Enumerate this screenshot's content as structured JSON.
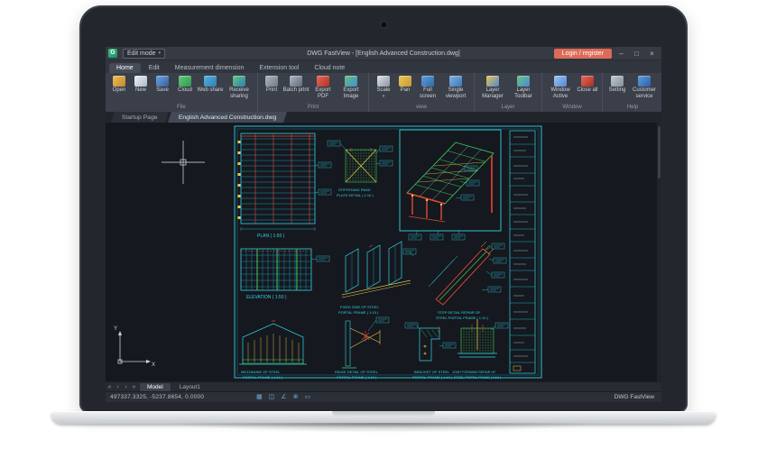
{
  "titlebar": {
    "edit_mode": "Edit mode",
    "title": "DWG FastView - [English Advanced Construction.dwg]",
    "login": "Login / register"
  },
  "icons": {
    "caret": "▾",
    "minimize": "–",
    "maximize": "□",
    "close": "×",
    "logo": "G",
    "nav_first": "«",
    "nav_prev": "‹",
    "nav_next": "›",
    "nav_last": "»",
    "status": [
      "▦",
      "◫",
      "∠",
      "⊕",
      "▭"
    ]
  },
  "ribbon": {
    "tabs": [
      {
        "label": "Home"
      },
      {
        "label": "Edit"
      },
      {
        "label": "Measurement dimension"
      },
      {
        "label": "Extension tool"
      },
      {
        "label": "Cloud note"
      }
    ],
    "groups": [
      {
        "label": "File",
        "buttons": [
          "Open",
          "New",
          "Save",
          "Cloud",
          "Web share",
          "Receive sharing"
        ]
      },
      {
        "label": "Print",
        "buttons": [
          "Print",
          "Batch print",
          "Export PDF",
          "Export Image"
        ]
      },
      {
        "label": "view",
        "buttons": [
          "Scale",
          "Pan",
          "Full screen",
          "Single viewport"
        ]
      },
      {
        "label": "Layer",
        "buttons": [
          "Layer Manager",
          "Layer Toolbar"
        ]
      },
      {
        "label": "Window",
        "buttons": [
          "Window Active",
          "Close all"
        ]
      },
      {
        "label": "Help",
        "buttons": [
          "Setting",
          "Customer service"
        ]
      }
    ]
  },
  "doc_tabs": {
    "startup": "Startup Page",
    "active": "English Advanced Construction.dwg"
  },
  "drawing": {
    "plan_label": "PLAN ( 1:50 )",
    "elevation_label": "ELEVATION ( 1:50 )",
    "stiffener_1": "STIFFENING RAKE",
    "stiffener_2": "PLATE DETAIL ( 1:10 )",
    "frames_1": "FIXED SIDE OF STEEL",
    "frames_2": "PORTAL FRAME ( 1:10 )",
    "step_1": "STEP DETAIL REPAIR OF",
    "step_2": "STEEL PORTAL FRAME ( 1:10 )",
    "gable_1": "MEZZANINE OF STEEL",
    "gable_2": "PORTAL FRAME ( 1:10 )",
    "ridge_1": "RIDGE DETAIL OF STEEL",
    "ridge_2": "PORTAL FRAME ( 1:10 )",
    "bracket_1": "BRACKET OF STEEL",
    "bracket_2": "PORTAL FRAME ( 1:10 )",
    "footing_1": "JOINT FORMING REPAIR OF",
    "footing_2": "STEEL PORTAL FRAME ( 1:10 )",
    "axis_x": "X",
    "axis_y": "Y"
  },
  "viewbar": {
    "model": "Model",
    "layout1": "Layout1"
  },
  "statusbar": {
    "coordinates": "497337.3325, -5237.8654, 0.0000",
    "brand": "DWG FastView"
  }
}
